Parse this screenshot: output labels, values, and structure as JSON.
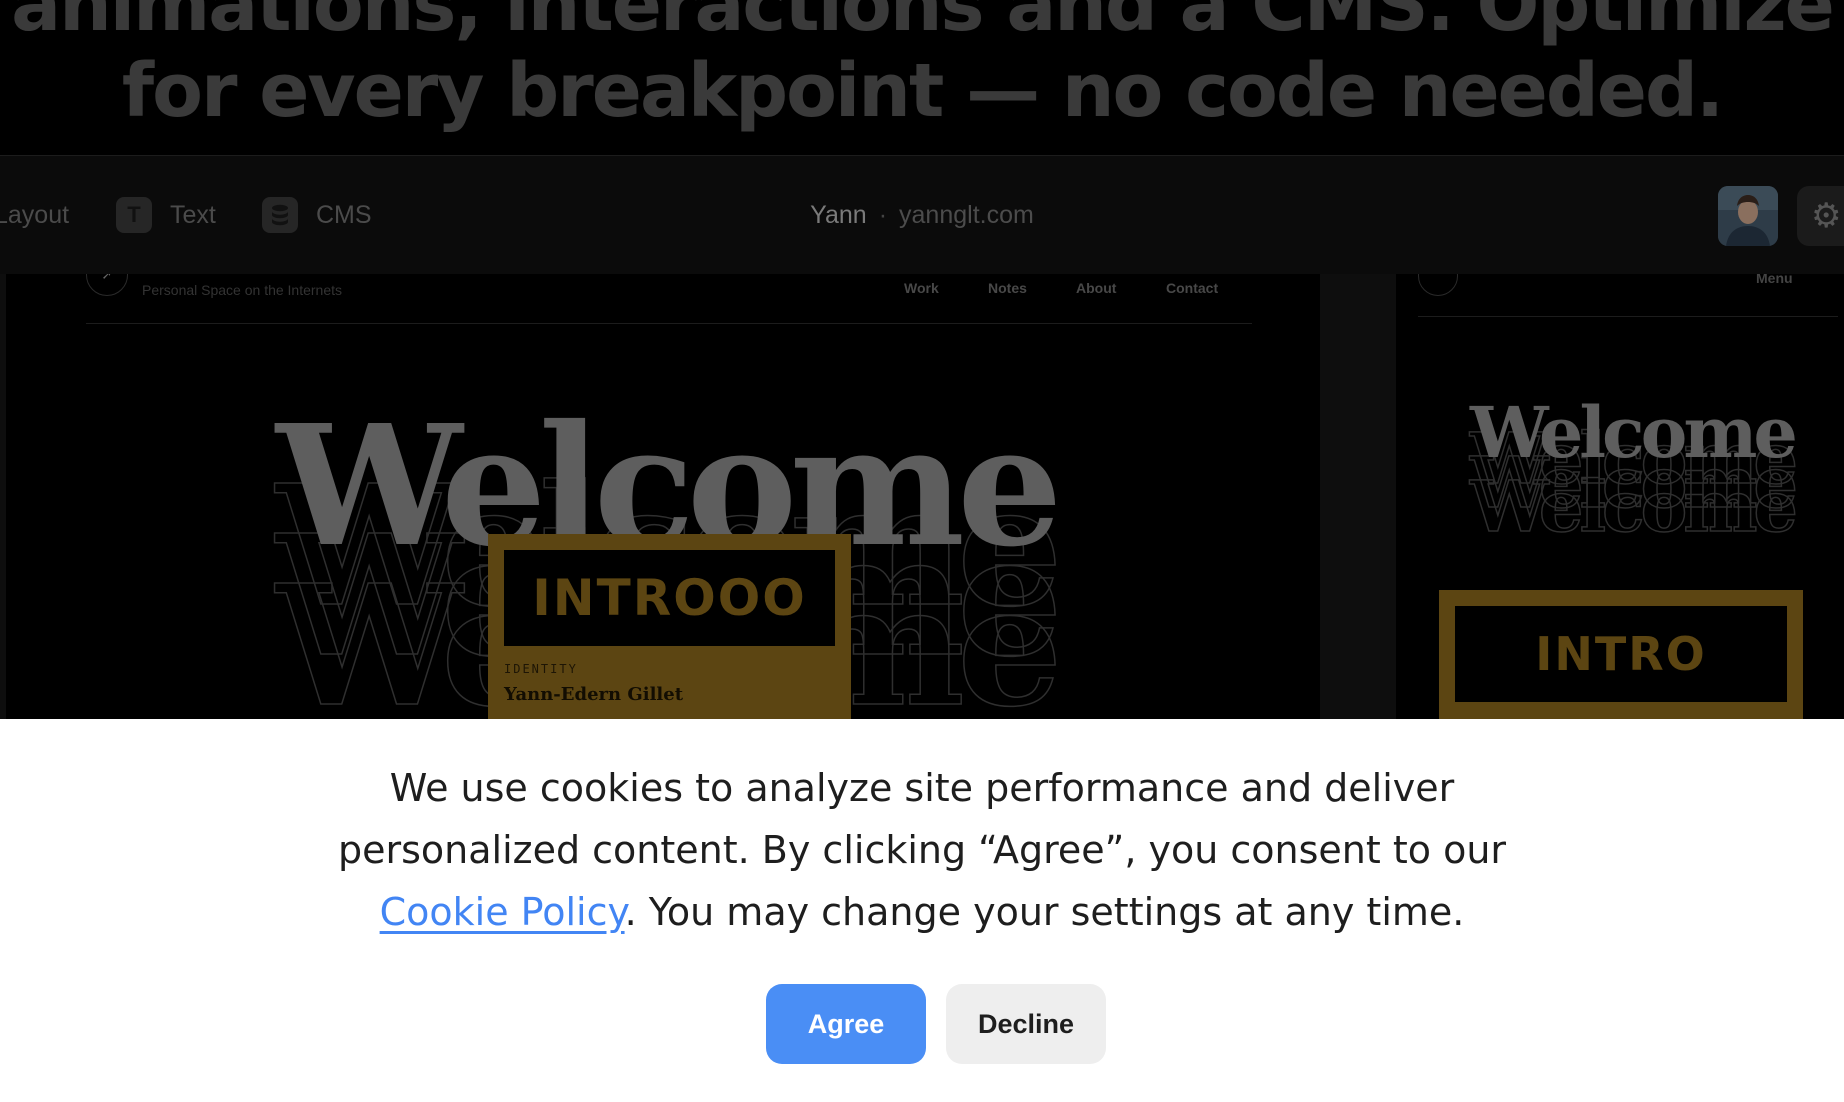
{
  "hero": {
    "line1": "animations, interactions and a CMS. Optimize",
    "line2": "for every breakpoint — no code needed."
  },
  "toolbar": {
    "items": [
      {
        "label": "Layout",
        "icon": "layout-icon"
      },
      {
        "label": "Text",
        "icon": "text-icon",
        "glyph": "T"
      },
      {
        "label": "CMS",
        "icon": "database-icon"
      }
    ],
    "site_name": "Yann",
    "separator": "·",
    "site_url": "yannglt.com",
    "settings_icon": "gear-icon"
  },
  "desktop_preview": {
    "tagline": "Personal Space on the Internets",
    "nav": [
      "Work",
      "Notes",
      "About",
      "Contact"
    ],
    "welcome": "Welcome",
    "intro_title": "INTROOO",
    "identity_label": "IDENTITY",
    "identity_name": "Yann-Edern Gillet"
  },
  "mobile_preview": {
    "menu": "Menu",
    "welcome": "Welcome",
    "intro_title": "INTRO"
  },
  "cookie_banner": {
    "line1": "We use cookies to analyze site performance and deliver",
    "line2": "personalized content. By clicking “Agree”, you consent to our",
    "link_text": "Cookie Policy",
    "line3_rest": ". You may change your settings at any time.",
    "agree_label": "Agree",
    "decline_label": "Decline",
    "colors": {
      "agree": "#4a8ef5",
      "link": "#4285f4",
      "decline": "#eeeeee"
    }
  }
}
